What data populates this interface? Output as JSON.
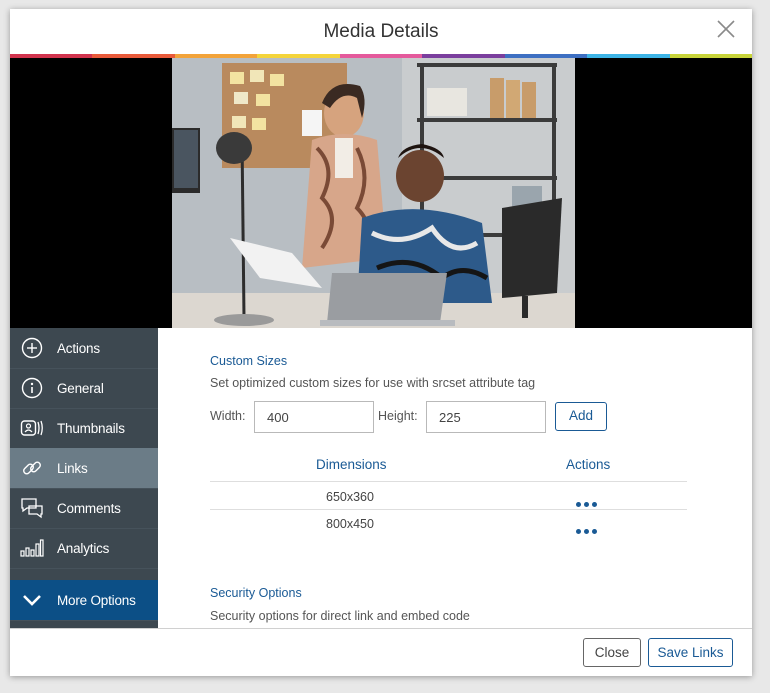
{
  "dialog": {
    "title": "Media Details",
    "accent_stripe_colors": [
      "#d1334d",
      "#e85a3a",
      "#f2a33a",
      "#f4d43b",
      "#e45a9c",
      "#7a3e9d",
      "#3d6fc2",
      "#3db4e6",
      "#c8d43a"
    ]
  },
  "media": {
    "alt": "Two people working at a desk with a laptop"
  },
  "sidebar": {
    "items": [
      {
        "label": "Actions",
        "icon": "plus-circle-icon"
      },
      {
        "label": "General",
        "icon": "info-circle-icon"
      },
      {
        "label": "Thumbnails",
        "icon": "thumbnails-icon"
      },
      {
        "label": "Links",
        "icon": "link-icon",
        "active": true
      },
      {
        "label": "Comments",
        "icon": "comments-icon"
      },
      {
        "label": "Analytics",
        "icon": "analytics-icon"
      },
      {
        "label": "More Options",
        "icon": "chevron-down-icon"
      }
    ]
  },
  "custom_sizes": {
    "title": "Custom Sizes",
    "description": "Set optimized custom sizes for use with srcset attribute tag",
    "width_label": "Width:",
    "width_value": "400",
    "height_label": "Height:",
    "height_value": "225",
    "add_label": "Add",
    "table": {
      "headers": [
        "Dimensions",
        "Actions"
      ],
      "rows": [
        "650x360",
        "800x450"
      ]
    }
  },
  "security": {
    "title": "Security Options",
    "description": "Security options for direct link and embed code"
  },
  "footer": {
    "close_label": "Close",
    "save_label": "Save Links"
  },
  "colors": {
    "sidebar_bg": "#3d4850",
    "sidebar_active": "#6b7c87",
    "more_options_bg": "#0c4f86",
    "accent_blue": "#1a5a95"
  }
}
